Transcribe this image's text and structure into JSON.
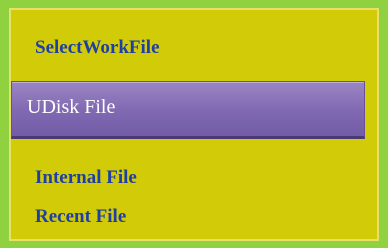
{
  "header": {
    "title": "SelectWorkFile"
  },
  "menu": {
    "items": [
      {
        "label": "UDisk File",
        "selected": true
      },
      {
        "label": "Internal File",
        "selected": false
      },
      {
        "label": "Recent File",
        "selected": false
      }
    ]
  },
  "colors": {
    "outer_border": "#8fd13f",
    "panel_background": "#d2cb07",
    "text": "#1f3fa6",
    "selected_background": "#8068b2",
    "selected_text": "#ffffff"
  }
}
